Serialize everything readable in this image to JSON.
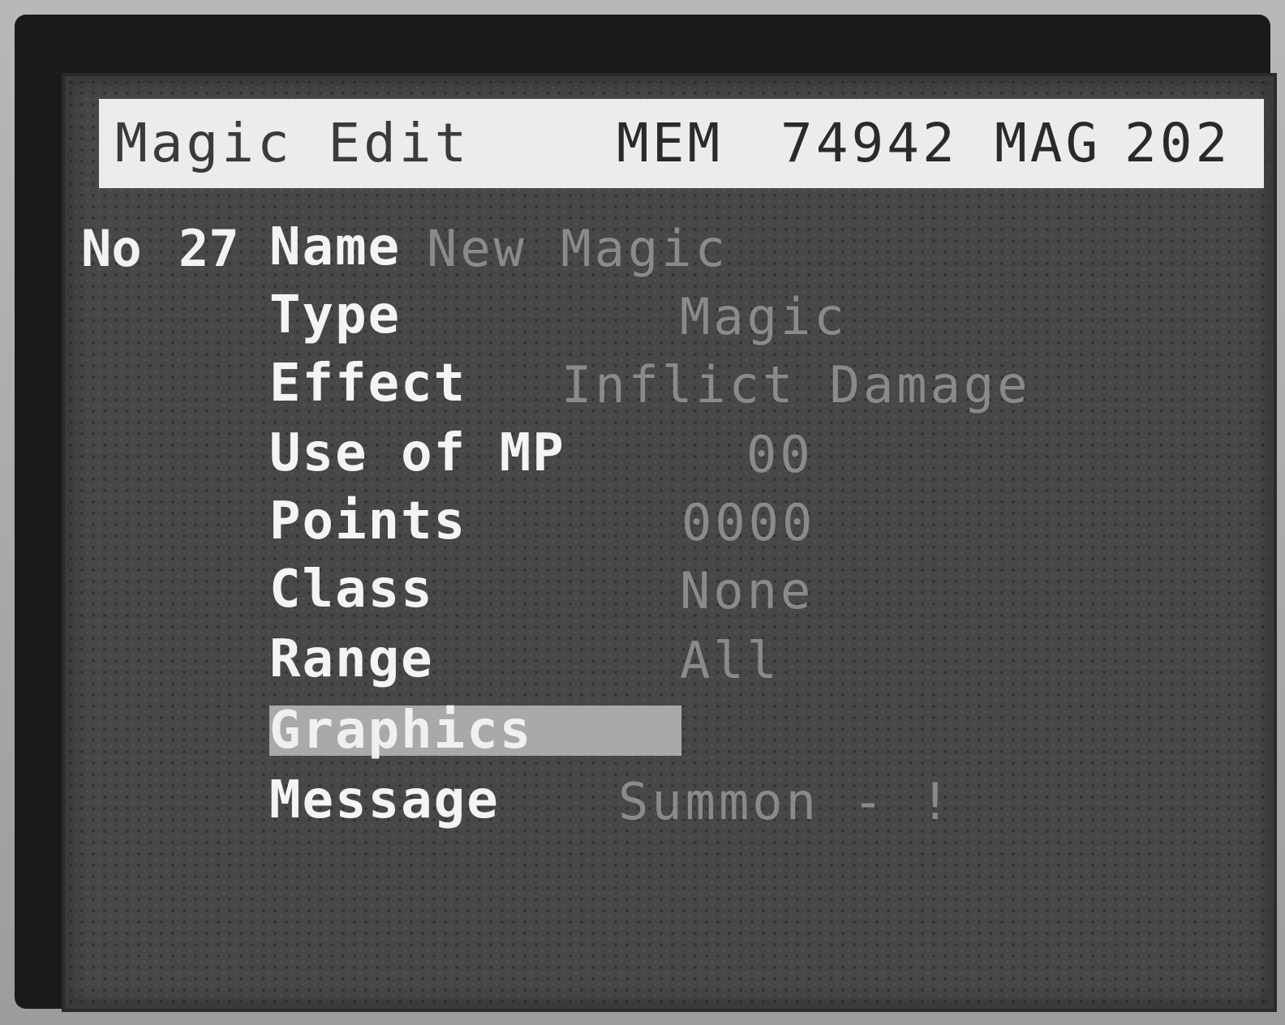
{
  "header": {
    "title": "Magic Edit",
    "mem_label": "MEM",
    "mem_value": "74942",
    "mag_label": "MAG",
    "mag_value": "202"
  },
  "record": {
    "no_label": "No",
    "no_value": "27"
  },
  "fields": [
    {
      "label": "Name",
      "value": "New Magic"
    },
    {
      "label": "Type",
      "value": "Magic"
    },
    {
      "label": "Effect",
      "value": "Inflict Damage"
    },
    {
      "label": "Use of MP",
      "value": "00"
    },
    {
      "label": "Points",
      "value": "0000"
    },
    {
      "label": "Class",
      "value": "None"
    },
    {
      "label": "Range",
      "value": "All"
    },
    {
      "label": "Graphics",
      "value": ""
    },
    {
      "label": "Message",
      "value": "Summon - !"
    }
  ],
  "selected_field": "Graphics",
  "colors": {
    "screen_bg": "#474747",
    "header_bg": "#ececec",
    "label_text": "#f4f4f4",
    "value_text": "#8a8a8a",
    "selection_bar": "#a9a9a9"
  }
}
